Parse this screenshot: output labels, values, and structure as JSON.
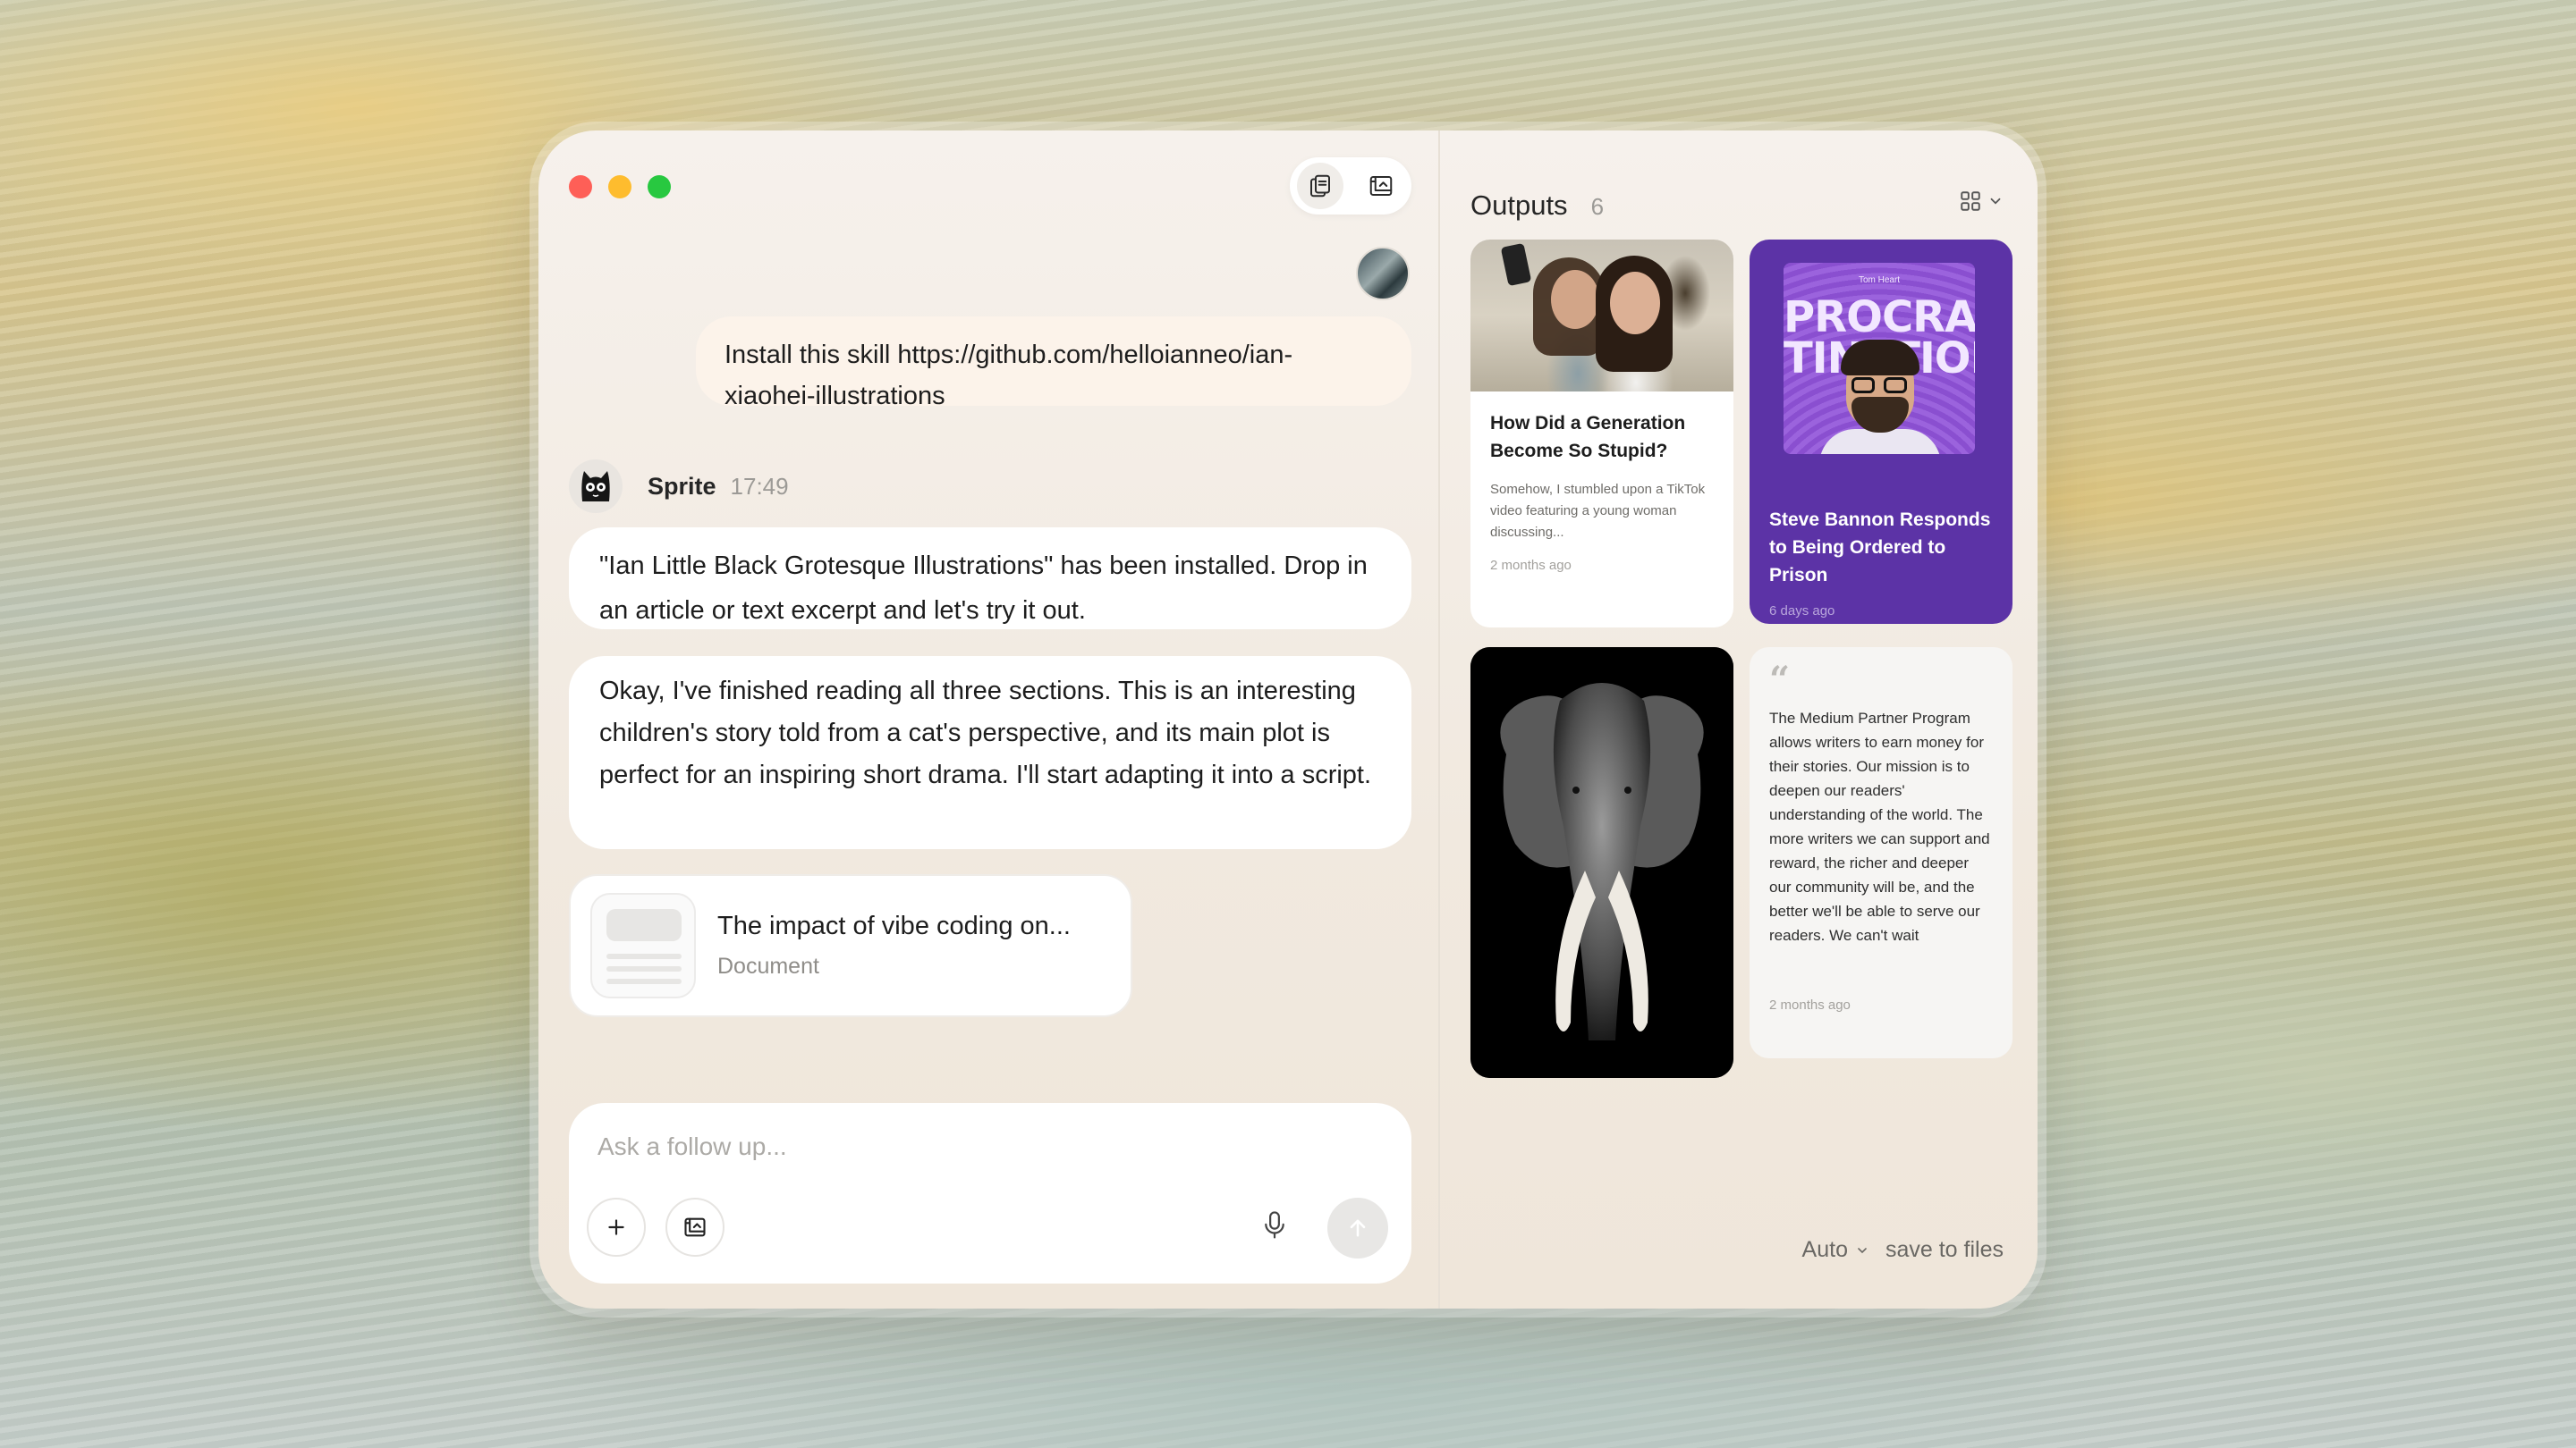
{
  "chat": {
    "user_message": "Install this skill https://github.com/helloianneo/ian-xiaohei-illustrations",
    "assistant": {
      "name": "Sprite",
      "time": "17:49"
    },
    "messages": [
      "\"Ian Little Black Grotesque Illustrations\" has been installed. Drop in an article or text excerpt and let's try it out.",
      "Okay, I've finished reading all three sections. This is an interesting children's story told from a cat's perspective, and its main plot is perfect for an inspiring short drama. I'll start adapting it into a script."
    ],
    "document": {
      "title": "The impact of vibe coding on...",
      "type": "Document"
    },
    "input": {
      "placeholder": "Ask a follow up..."
    }
  },
  "outputs": {
    "title": "Outputs",
    "count": "6",
    "cards": [
      {
        "title": "How Did a Generation Become So Stupid?",
        "excerpt": "Somehow, I stumbled upon a TikTok video featuring a young woman discussing...",
        "time": "2 months ago"
      },
      {
        "podcast_author": "Tom Heart",
        "podcast_title": "PROCRASTINATION",
        "title": "Steve Bannon Responds to Being Ordered to Prison",
        "time": "6 days ago"
      },
      {
        "image": "elephant-photo"
      },
      {
        "quote": "The Medium Partner Program allows writers to earn money for their stories. Our mission is to deepen our readers' understanding of the world. The more writers we can support and reward, the richer and deeper our community will be, and the better we'll be able to serve our readers. We can't wait",
        "time": "2 months ago"
      }
    ],
    "footer": {
      "mode": "Auto",
      "save_label": "save to files"
    }
  },
  "colors": {
    "purple_card": "#5c33a6",
    "close": "#fe5f57",
    "minimize": "#febc2e",
    "zoom": "#28c840"
  }
}
